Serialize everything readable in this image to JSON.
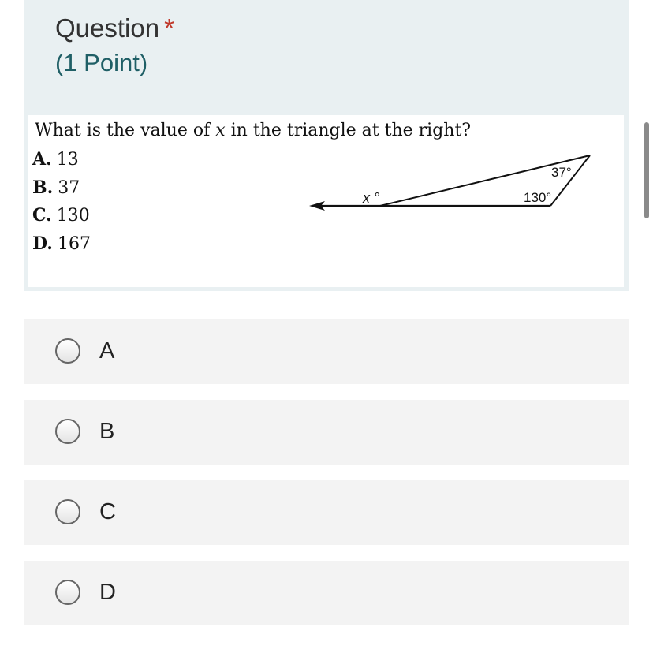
{
  "question": {
    "title": "Question",
    "required_mark": "*",
    "points": "(1 Point)",
    "prompt_before": "What is the value of ",
    "prompt_var": "x",
    "prompt_after": " in the triangle at the right?",
    "choices": [
      {
        "letter": "A.",
        "value": "13"
      },
      {
        "letter": "B.",
        "value": "37"
      },
      {
        "letter": "C.",
        "value": "130"
      },
      {
        "letter": "D.",
        "value": "167"
      }
    ],
    "figure": {
      "exterior_angle_label": "x °",
      "top_angle_label": "37°",
      "right_angle_label": "130°"
    }
  },
  "options": [
    {
      "label": "A",
      "selected": false
    },
    {
      "label": "B",
      "selected": false
    },
    {
      "label": "C",
      "selected": false
    },
    {
      "label": "D",
      "selected": false
    }
  ],
  "colors": {
    "card_background": "#e9f0f2",
    "option_background": "#f3f3f3",
    "points_color": "#1f5f66",
    "required_color": "#c0392b"
  }
}
